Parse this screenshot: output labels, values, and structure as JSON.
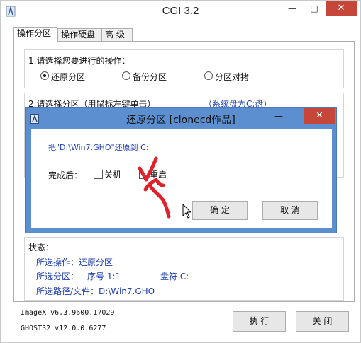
{
  "window": {
    "title": "CGI 3.2",
    "min": "—",
    "max": "□",
    "close": "✕"
  },
  "tabs": [
    {
      "label": "操作分区"
    },
    {
      "label": "操作硬盘"
    },
    {
      "label": "高  级"
    }
  ],
  "step1": {
    "heading": "1.请选择您要进行的操作：",
    "options": [
      {
        "label": "还原分区",
        "selected": true
      },
      {
        "label": "备份分区",
        "selected": false
      },
      {
        "label": "分区对拷",
        "selected": false
      }
    ]
  },
  "step2": {
    "heading": "2.请选择分区（用鼠标左键单击）",
    "system_note": "（系统盘为C:盘）"
  },
  "status": {
    "heading": "状态：",
    "operation": "所选操作：还原分区",
    "partition_label": "所选分区：",
    "partition_number": "序号 1:1",
    "drive_letter": "盘符 C:",
    "path": "所选路径/文件：D:\\Win7.GHO"
  },
  "versions": {
    "imagex": "ImageX v6.3.9600.17029",
    "ghost": "GHOST32 v12.0.0.6277"
  },
  "buttons": {
    "execute": "执 行",
    "close": "关 闭"
  },
  "dialog": {
    "title": "还原分区  [clonecd作品]",
    "message": "把\"D:\\Win7.GHO\"还原到 C:",
    "completion_label": "完成后：",
    "shutdown_label": "关机",
    "restart_label": "重启",
    "confirm": "确 定",
    "cancel": "取 消",
    "close": "✕",
    "min": "—"
  },
  "colors": {
    "dialog_frame": "#5b8fd0",
    "close_button": "#c7463a",
    "info_text": "#1f3fae",
    "annotation": "#e0202a"
  }
}
